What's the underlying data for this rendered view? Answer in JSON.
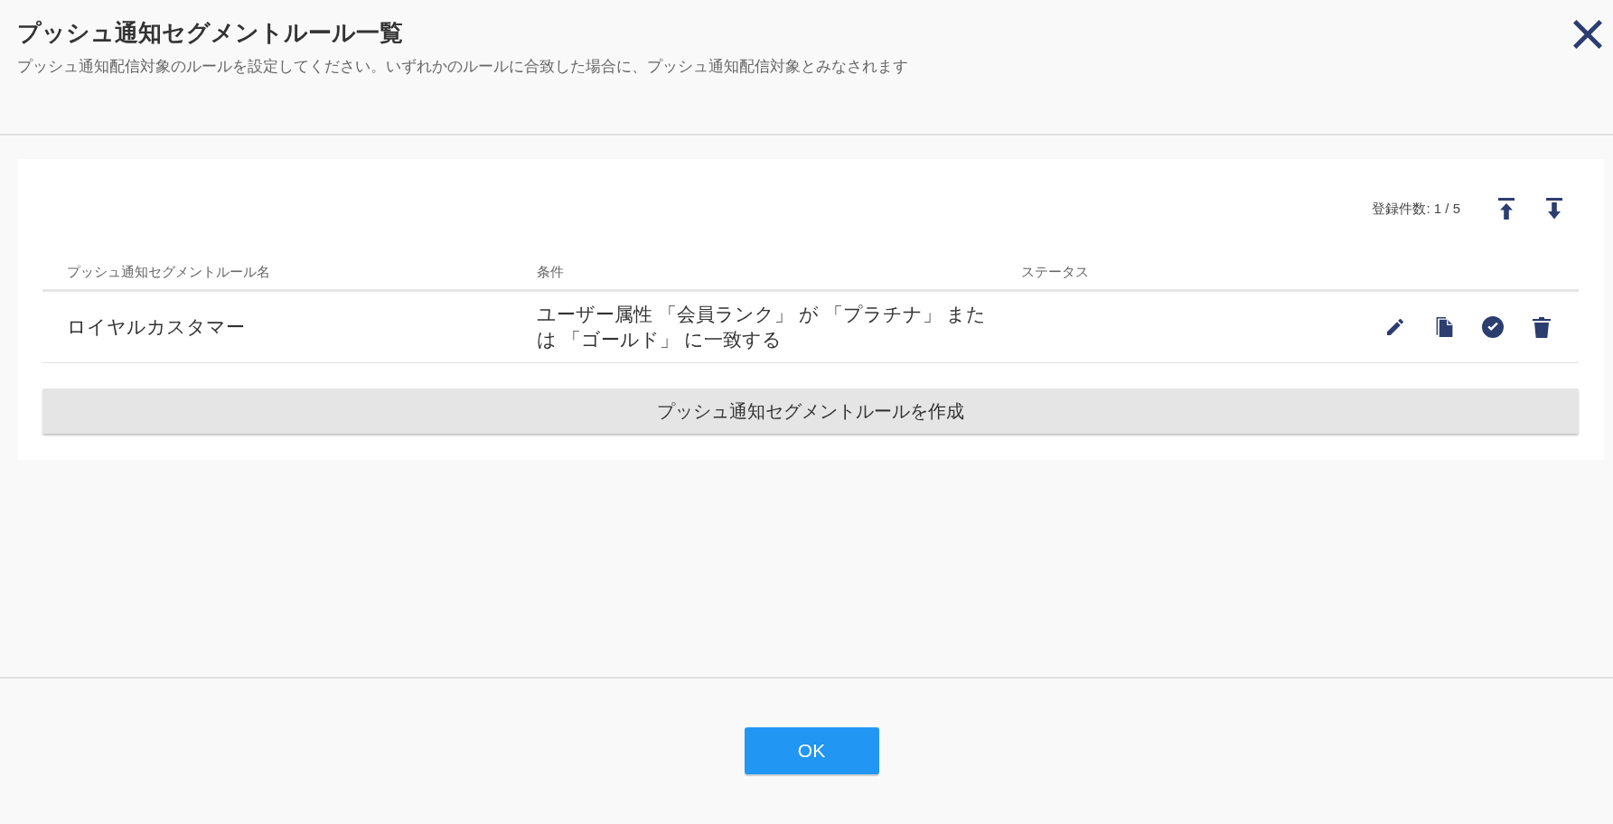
{
  "dialog": {
    "title": "プッシュ通知セグメントルール一覧",
    "description": "プッシュ通知配信対象のルールを設定してください。いずれかのルールに合致した場合に、プッシュ通知配信対象とみなされます"
  },
  "list": {
    "count": "登録件数: 1 / 5",
    "columns": [
      "プッシュ通知セグメントルール名",
      "条件",
      "ステータス"
    ],
    "rows": [
      {
        "name": "ロイヤルカスタマー",
        "condition": "ユーザー属性 「会員ランク」 が 「プラチナ」 または 「ゴールド」 に一致する"
      }
    ],
    "create_button": "プッシュ通知セグメントルールを作成"
  },
  "footer": {
    "ok_button": "OK"
  }
}
